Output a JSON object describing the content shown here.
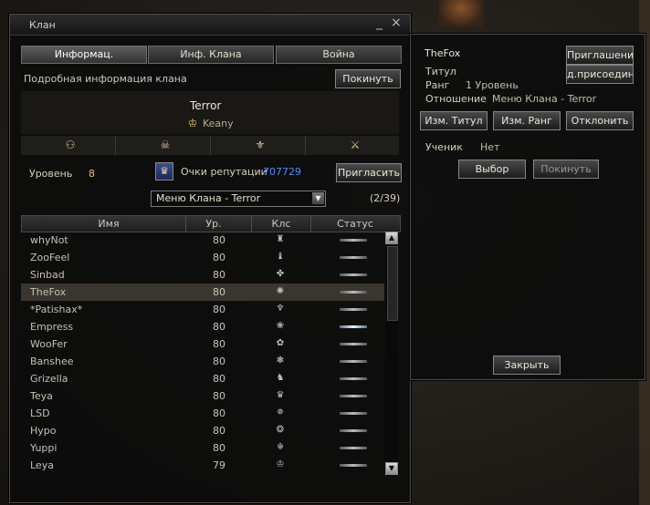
{
  "clan_window": {
    "title": "Клан",
    "tabs": [
      "Информац.",
      "Инф. Клана",
      "Война"
    ],
    "detail_label": "Подробная информация клана",
    "leave_button": "Покинуть",
    "clan_name": "Terror",
    "leader_name": "Keany",
    "level_label": "Уровень",
    "level_value": "8",
    "reputation_label": "Очки репутации",
    "reputation_value": "707729",
    "invite_button": "Пригласить",
    "menu_select": "Меню Клана - Terror",
    "member_count": "(2/39)",
    "columns": [
      "Имя",
      "Ур.",
      "Клс",
      "Статус"
    ],
    "members": [
      {
        "name": "whyNot",
        "level": "80",
        "online": false,
        "selected": false
      },
      {
        "name": "ZooFeel",
        "level": "80",
        "online": false,
        "selected": false
      },
      {
        "name": "Sinbad",
        "level": "80",
        "online": false,
        "selected": false
      },
      {
        "name": "TheFox",
        "level": "80",
        "online": false,
        "selected": true
      },
      {
        "name": "*Patishax*",
        "level": "80",
        "online": false,
        "selected": false
      },
      {
        "name": "Empress",
        "level": "80",
        "online": true,
        "selected": false
      },
      {
        "name": "WooFer",
        "level": "80",
        "online": false,
        "selected": false
      },
      {
        "name": "Banshee",
        "level": "80",
        "online": false,
        "selected": false
      },
      {
        "name": "Grizella",
        "level": "80",
        "online": false,
        "selected": false
      },
      {
        "name": "Teya",
        "level": "80",
        "online": false,
        "selected": false
      },
      {
        "name": "LSD",
        "level": "80",
        "online": false,
        "selected": false
      },
      {
        "name": "Hypo",
        "level": "80",
        "online": false,
        "selected": false
      },
      {
        "name": "Yuppi",
        "level": "80",
        "online": false,
        "selected": false
      },
      {
        "name": "Leya",
        "level": "79",
        "online": false,
        "selected": false
      }
    ]
  },
  "member_window": {
    "name": "TheFox",
    "invite_button": "Приглашение",
    "join_button": "д.присоедине",
    "title_label": "Титул",
    "rank_label": "Ранг",
    "rank_value": "1 Уровень",
    "relation_label": "Отношение",
    "relation_value": "Меню Клана - Terror",
    "change_title_button": "Изм. Титул",
    "change_rank_button": "Изм. Ранг",
    "dismiss_button": "Отклонить",
    "student_label": "Ученик",
    "student_value": "Нет",
    "select_button": "Выбор",
    "leave_button": "Покинуть",
    "close_button": "Закрыть"
  },
  "colors": {
    "reputation": "#4f8fff",
    "level_value": "#e8c070"
  }
}
